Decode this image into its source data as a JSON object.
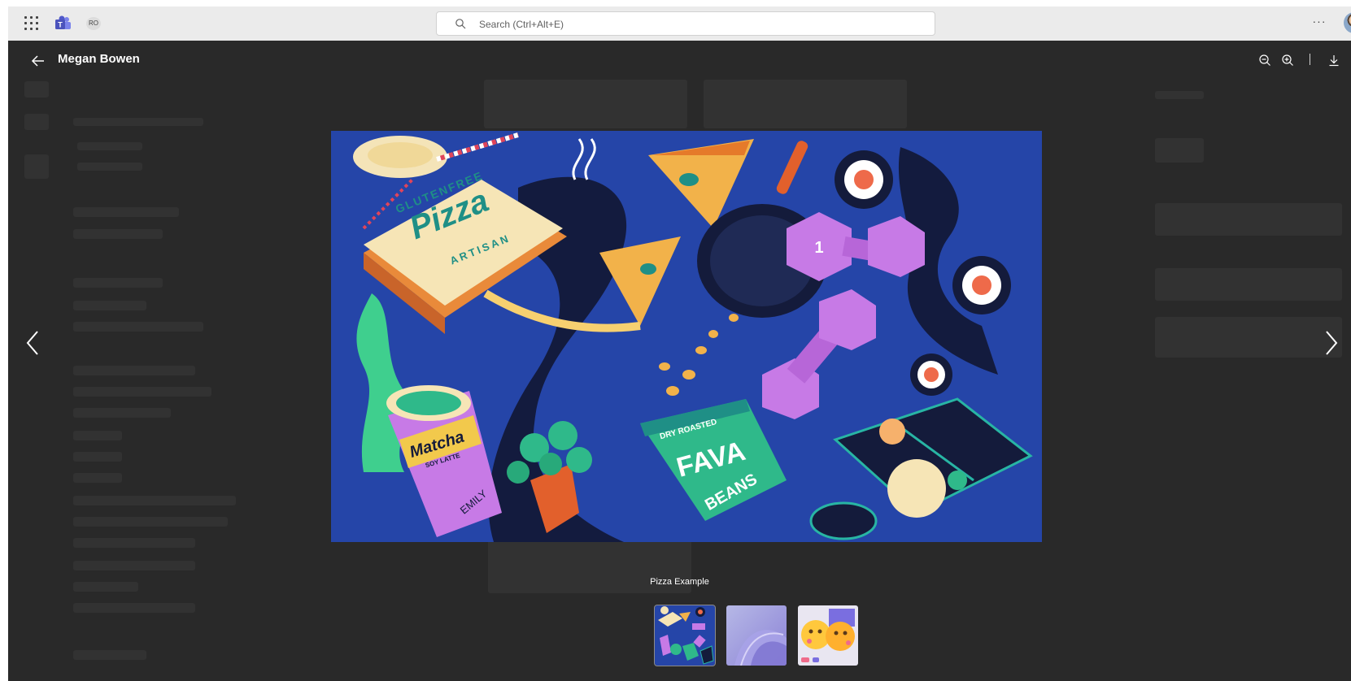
{
  "topbar": {
    "app_icons": [
      "apps-grid-icon",
      "teams-logo-icon"
    ],
    "account_initials": "RO",
    "search": {
      "placeholder": "Search (Ctrl+Alt+E)",
      "value": ""
    },
    "more_label": "···"
  },
  "viewer": {
    "title": "Megan Bowen",
    "actions": [
      "zoom-out-icon",
      "zoom-in-icon",
      "download-icon"
    ],
    "image_caption": "Pizza Example",
    "thumbnails": [
      {
        "name": "pizza-example-thumbnail",
        "selected": true
      },
      {
        "name": "abstract-purple-thumbnail",
        "selected": false
      },
      {
        "name": "emoji-faces-thumbnail",
        "selected": false
      }
    ]
  },
  "image_text": {
    "box_top": "GLUTENFREE",
    "box_main": "Pizza",
    "box_bottom": "ARTISAN",
    "cup_main": "Matcha",
    "cup_sub": "SOY LATTE",
    "cup_name": "EMILY",
    "bag_top": "DRY ROASTED",
    "bag_main": "FAVA",
    "bag_sub": "BEANS",
    "weight_num": "1"
  },
  "colors": {
    "viewer_bg": "#292929",
    "topbar_bg": "#ebebeb",
    "image_bg": "#2545a8",
    "text": "#ffffff"
  }
}
